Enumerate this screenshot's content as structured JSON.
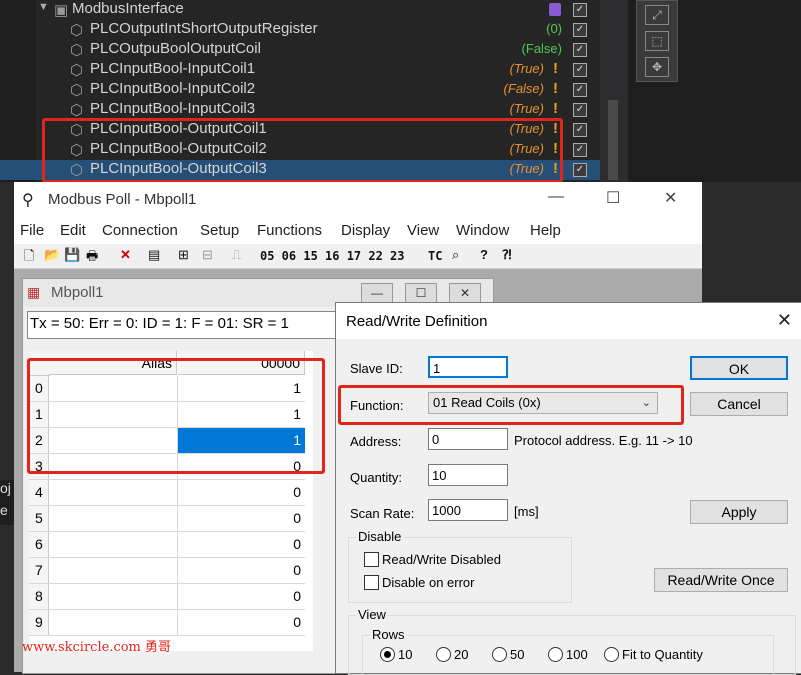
{
  "ide_tree": {
    "root": {
      "label": "ModbusInterface"
    },
    "rows": [
      {
        "label": "PLCOutputIntShortOutputRegister",
        "value": "(0)",
        "value_color": "green",
        "warning": false
      },
      {
        "label": "PLCOutpuBoolOutputCoil",
        "value": "(False)",
        "value_color": "green",
        "warning": false
      },
      {
        "label": "PLCInputBool-InputCoil1",
        "value": "(True)",
        "value_color": "orange",
        "warning": true
      },
      {
        "label": "PLCInputBool-InputCoil2",
        "value": "(False)",
        "value_color": "orange",
        "warning": true
      },
      {
        "label": "PLCInputBool-InputCoil3",
        "value": "(True)",
        "value_color": "orange",
        "warning": true
      },
      {
        "label": "PLCInputBool-OutputCoil1",
        "value": "(True)",
        "value_color": "orange",
        "warning": true
      },
      {
        "label": "PLCInputBool-OutputCoil2",
        "value": "(True)",
        "value_color": "orange",
        "warning": true
      },
      {
        "label": "PLCInputBool-OutputCoil3",
        "value": "(True)",
        "value_color": "orange",
        "warning": true,
        "selected": true
      }
    ]
  },
  "side_labels": {
    "a": "oj",
    "b": "e"
  },
  "modbus_poll": {
    "title": "Modbus Poll - Mbpoll1",
    "menu": [
      "File",
      "Edit",
      "Connection",
      "Setup",
      "Functions",
      "Display",
      "View",
      "Window",
      "Help"
    ],
    "toolbar_codes": "05 06 15 16 17 22 23",
    "toolbar_tc": "TC",
    "child": {
      "title": "Mbpoll1",
      "status": "Tx = 50: Err = 0: ID = 1: F = 01: SR = 1",
      "grid": {
        "headers": {
          "alias": "Alias",
          "value": "00000"
        },
        "rows": [
          {
            "idx": "0",
            "value": "1"
          },
          {
            "idx": "1",
            "value": "1"
          },
          {
            "idx": "2",
            "value": "1"
          },
          {
            "idx": "3",
            "value": "0"
          },
          {
            "idx": "4",
            "value": "0"
          },
          {
            "idx": "5",
            "value": "0"
          },
          {
            "idx": "6",
            "value": "0"
          },
          {
            "idx": "7",
            "value": "0"
          },
          {
            "idx": "8",
            "value": "0"
          },
          {
            "idx": "9",
            "value": "0"
          }
        ]
      }
    }
  },
  "dialog": {
    "title": "Read/Write Definition",
    "slave_id_label": "Slave ID:",
    "slave_id": "1",
    "function_label": "Function:",
    "function_value": "01 Read Coils (0x)",
    "address_label": "Address:",
    "address": "0",
    "protocol_hint": "Protocol address. E.g. 11 -> 10",
    "quantity_label": "Quantity:",
    "quantity": "10",
    "scan_rate_label": "Scan Rate:",
    "scan_rate": "1000",
    "scan_unit": "[ms]",
    "ok": "OK",
    "cancel": "Cancel",
    "apply": "Apply",
    "rw_once": "Read/Write Once",
    "disable_group": "Disable",
    "rw_disabled": "Read/Write Disabled",
    "disable_on_error": "Disable on error",
    "view_group": "View",
    "rows_group": "Rows",
    "row_options": [
      "10",
      "20",
      "50",
      "100",
      "Fit to Quantity"
    ]
  },
  "watermark": "www.skcircle.com 勇哥"
}
